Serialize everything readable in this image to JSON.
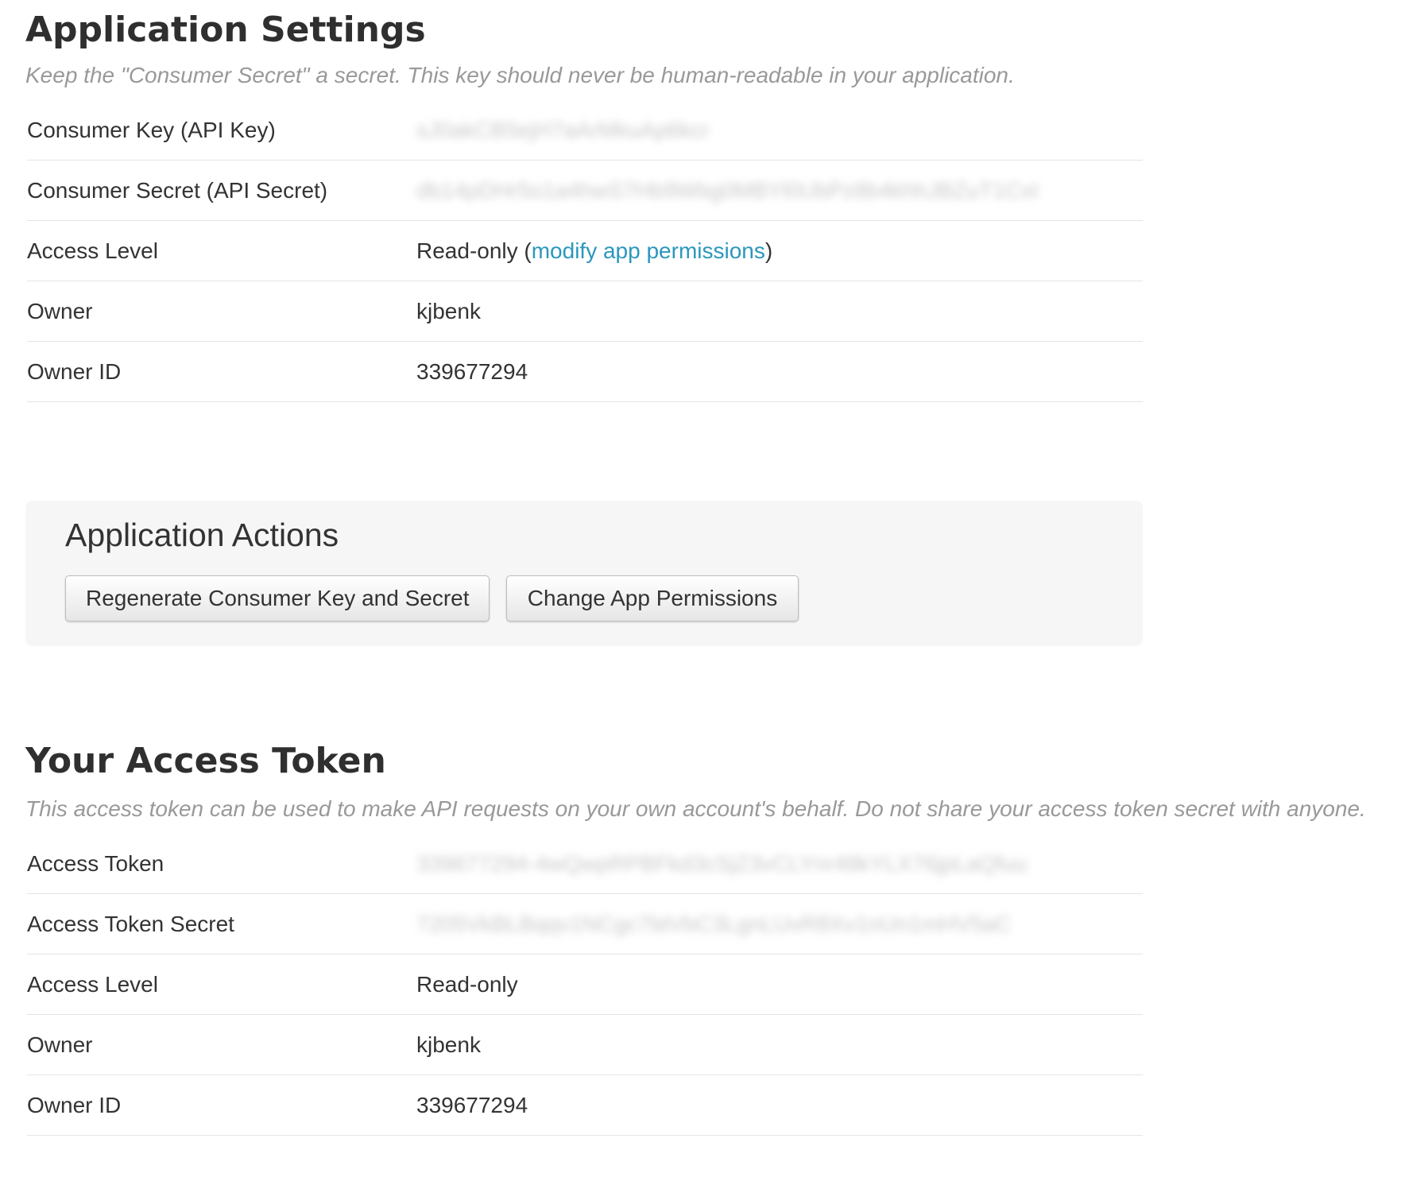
{
  "app_settings": {
    "title": "Application Settings",
    "description": "Keep the \"Consumer Secret\" a secret. This key should never be human-readable in your application.",
    "rows": [
      {
        "label": "Consumer Key (API Key)",
        "value": "sJ0akCB5ejH7aArMkuAp6kcr"
      },
      {
        "label": "Consumer Secret (API Secret)",
        "value": "db14pDHr5o1a4hwS7Hb9Wbg0MBYl0UbPz8b4khhJBZuT1CxI"
      },
      {
        "label": "Access Level",
        "value": "Read-only (",
        "link": "modify app permissions",
        "suffix": ")"
      },
      {
        "label": "Owner",
        "value": "kjbenk"
      },
      {
        "label": "Owner ID",
        "value": "339677294"
      }
    ]
  },
  "app_actions": {
    "title": "Application Actions",
    "regenerate_label": "Regenerate Consumer Key and Secret",
    "change_permissions_label": "Change App Permissions"
  },
  "access_token": {
    "title": "Your Access Token",
    "description": "This access token can be used to make API requests on your own account's behalf. Do not share your access token secret with anyone.",
    "rows": [
      {
        "label": "Access Token",
        "value": "339677294-4wQwpRPBFkd3cSjZ3vCLYnr48kYLX76jpLaQfuu"
      },
      {
        "label": "Access Token Secret",
        "value": "7205VkBLBqqv1NCgc7btVbC3LgnLUvR8Xv1nUn1mHV5aC"
      },
      {
        "label": "Access Level",
        "value": "Read-only"
      },
      {
        "label": "Owner",
        "value": "kjbenk"
      },
      {
        "label": "Owner ID",
        "value": "339677294"
      }
    ]
  },
  "colors": {
    "link": "#2b97bd",
    "description_text": "#999999",
    "actions_background": "#f6f6f6"
  }
}
